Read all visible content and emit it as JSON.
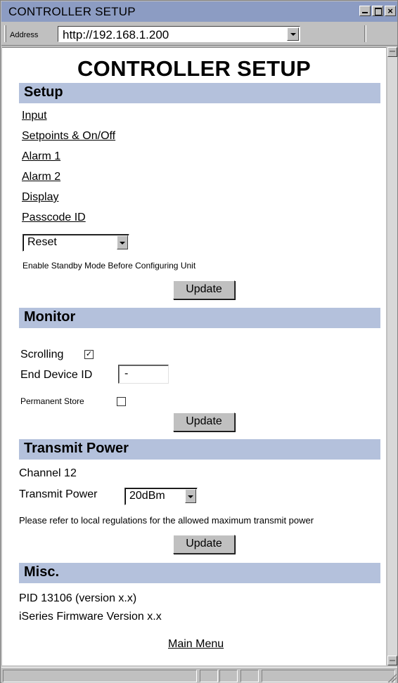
{
  "window": {
    "title": "CONTROLLER SETUP"
  },
  "addressbar": {
    "label": "Address",
    "url": "http://192.168.1.200"
  },
  "page": {
    "title": "CONTROLLER SETUP"
  },
  "setup": {
    "heading": "Setup",
    "links": [
      "Input",
      "Setpoints & On/Off",
      "Alarm 1",
      "Alarm 2",
      "Display",
      "Passcode ID"
    ],
    "reset_value": "Reset",
    "note": "Enable Standby Mode Before Configuring Unit",
    "update_label": "Update"
  },
  "monitor": {
    "heading": "Monitor",
    "scrolling_label": "Scrolling",
    "scrolling_checked": true,
    "end_device_label": "End Device ID",
    "end_device_value": "-",
    "permanent_label": "Permanent Store",
    "permanent_checked": false,
    "update_label": "Update"
  },
  "transmit": {
    "heading": "Transmit Power",
    "channel_text": "Channel 12",
    "power_label": "Transmit Power",
    "power_value": "20dBm",
    "note": "Please refer to local regulations for the allowed maximum transmit power",
    "update_label": "Update"
  },
  "misc": {
    "heading": "Misc.",
    "pid": "PID 13106 (version x.x)",
    "firmware": "iSeries Firmware Version x.x",
    "main_menu": "Main Menu"
  },
  "icons": {
    "check": "✓",
    "close": "×"
  }
}
